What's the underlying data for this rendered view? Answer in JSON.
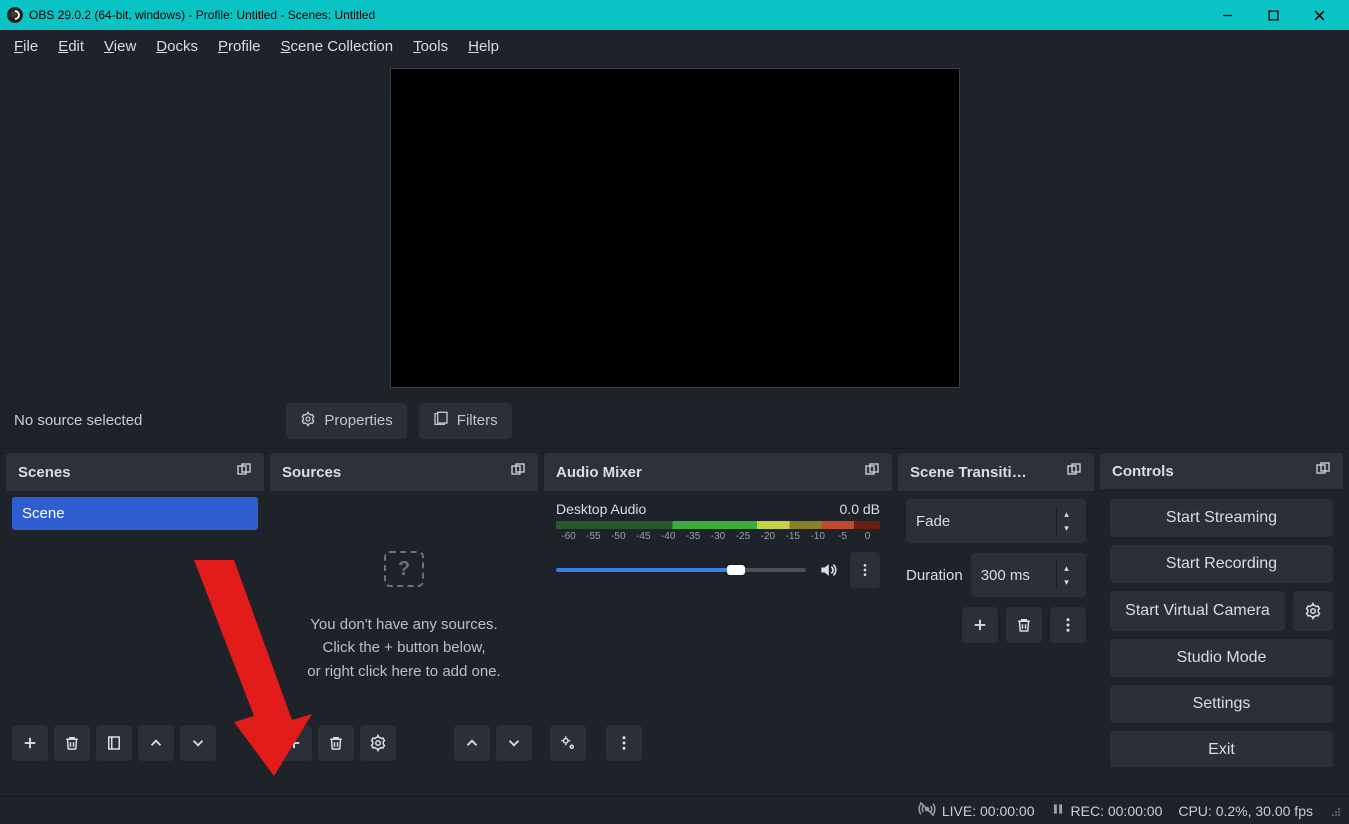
{
  "window": {
    "title": "OBS 29.0.2 (64-bit, windows) - Profile: Untitled - Scenes: Untitled"
  },
  "menu": [
    "File",
    "Edit",
    "View",
    "Docks",
    "Profile",
    "Scene Collection",
    "Tools",
    "Help"
  ],
  "source_toolbar": {
    "label": "No source selected",
    "properties": "Properties",
    "filters": "Filters"
  },
  "docks": {
    "scenes": {
      "title": "Scenes",
      "items": [
        "Scene"
      ]
    },
    "sources": {
      "title": "Sources",
      "empty_l1": "You don't have any sources.",
      "empty_l2": "Click the + button below,",
      "empty_l3": "or right click here to add one."
    },
    "audio": {
      "title": "Audio Mixer",
      "track_name": "Desktop Audio",
      "track_db": "0.0 dB",
      "ticks": [
        "-60",
        "-55",
        "-50",
        "-45",
        "-40",
        "-35",
        "-30",
        "-25",
        "-20",
        "-15",
        "-10",
        "-5",
        "0"
      ]
    },
    "transitions": {
      "title": "Scene Transiti…",
      "selected": "Fade",
      "duration_label": "Duration",
      "duration_value": "300 ms"
    },
    "controls": {
      "title": "Controls",
      "start_streaming": "Start Streaming",
      "start_recording": "Start Recording",
      "start_virtual_camera": "Start Virtual Camera",
      "studio_mode": "Studio Mode",
      "settings": "Settings",
      "exit": "Exit"
    }
  },
  "statusbar": {
    "live": "LIVE: 00:00:00",
    "rec": "REC: 00:00:00",
    "cpu": "CPU: 0.2%, 30.00 fps"
  }
}
